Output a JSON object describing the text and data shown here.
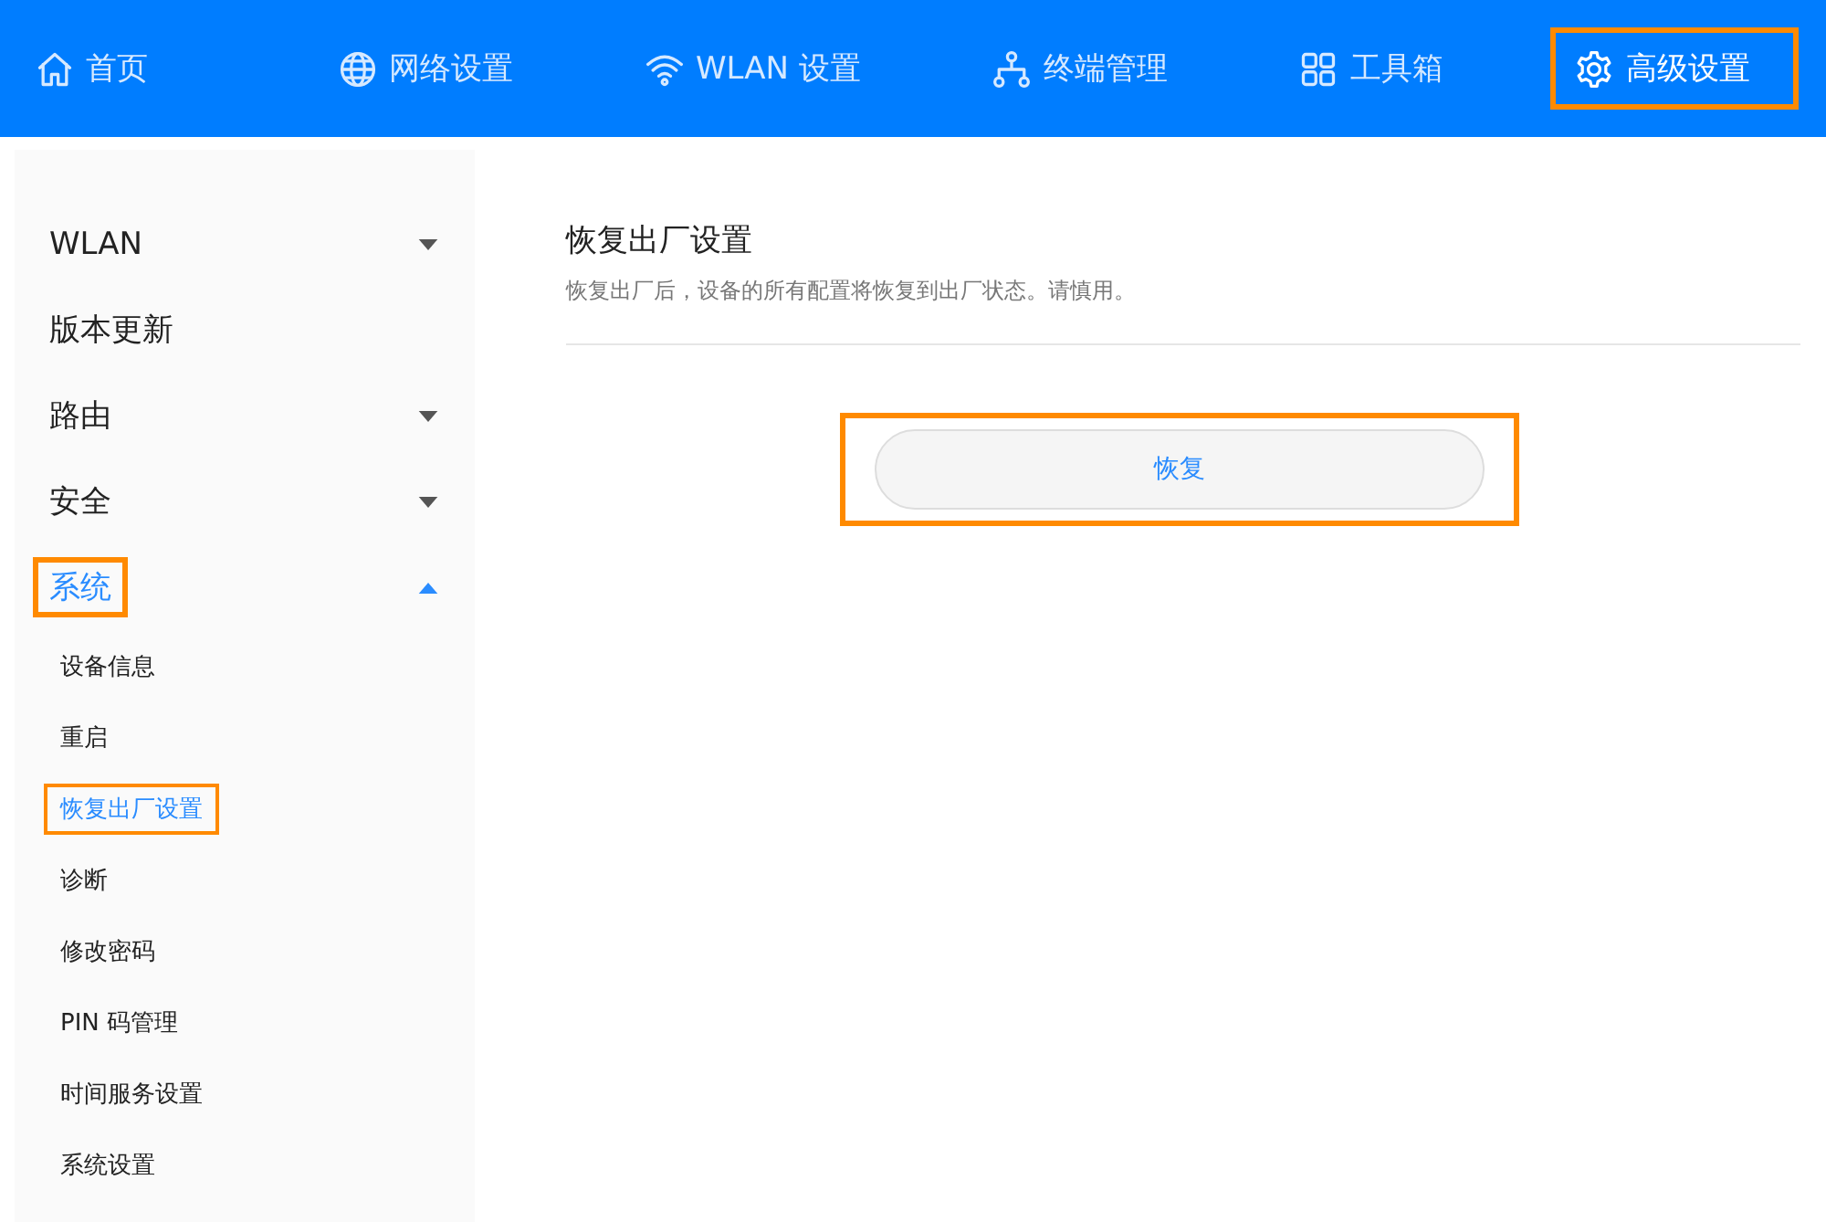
{
  "nav": [
    {
      "label": "首页",
      "selected": false,
      "highlighted": false
    },
    {
      "label": "网络设置",
      "selected": false,
      "highlighted": false
    },
    {
      "label": "WLAN 设置",
      "selected": false,
      "highlighted": false
    },
    {
      "label": "终端管理",
      "selected": false,
      "highlighted": false
    },
    {
      "label": "工具箱",
      "selected": false,
      "highlighted": false
    },
    {
      "label": "高级设置",
      "selected": true,
      "highlighted": true
    }
  ],
  "sidebar": {
    "items": [
      {
        "label": "WLAN",
        "expanded": false,
        "selected": false,
        "highlighted": false
      },
      {
        "label": "版本更新",
        "selected": false,
        "highlighted": false
      },
      {
        "label": "路由",
        "expanded": false,
        "selected": false,
        "highlighted": false
      },
      {
        "label": "安全",
        "expanded": false,
        "selected": false,
        "highlighted": false
      },
      {
        "label": "系统",
        "expanded": true,
        "selected": true,
        "highlighted": true,
        "children": [
          {
            "label": "设备信息",
            "selected": false,
            "highlighted": false
          },
          {
            "label": "重启",
            "selected": false,
            "highlighted": false
          },
          {
            "label": "恢复出厂设置",
            "selected": true,
            "highlighted": true
          },
          {
            "label": "诊断",
            "selected": false,
            "highlighted": false
          },
          {
            "label": "修改密码",
            "selected": false,
            "highlighted": false
          },
          {
            "label": "PIN 码管理",
            "selected": false,
            "highlighted": false
          },
          {
            "label": "时间服务设置",
            "selected": false,
            "highlighted": false
          },
          {
            "label": "系统设置",
            "selected": false,
            "highlighted": false
          }
        ]
      }
    ]
  },
  "content": {
    "title": "恢复出厂设置",
    "description": "恢复出厂后，设备的所有配置将恢复到出厂状态。请慎用。",
    "button": {
      "label": "恢复",
      "highlighted": true
    }
  }
}
